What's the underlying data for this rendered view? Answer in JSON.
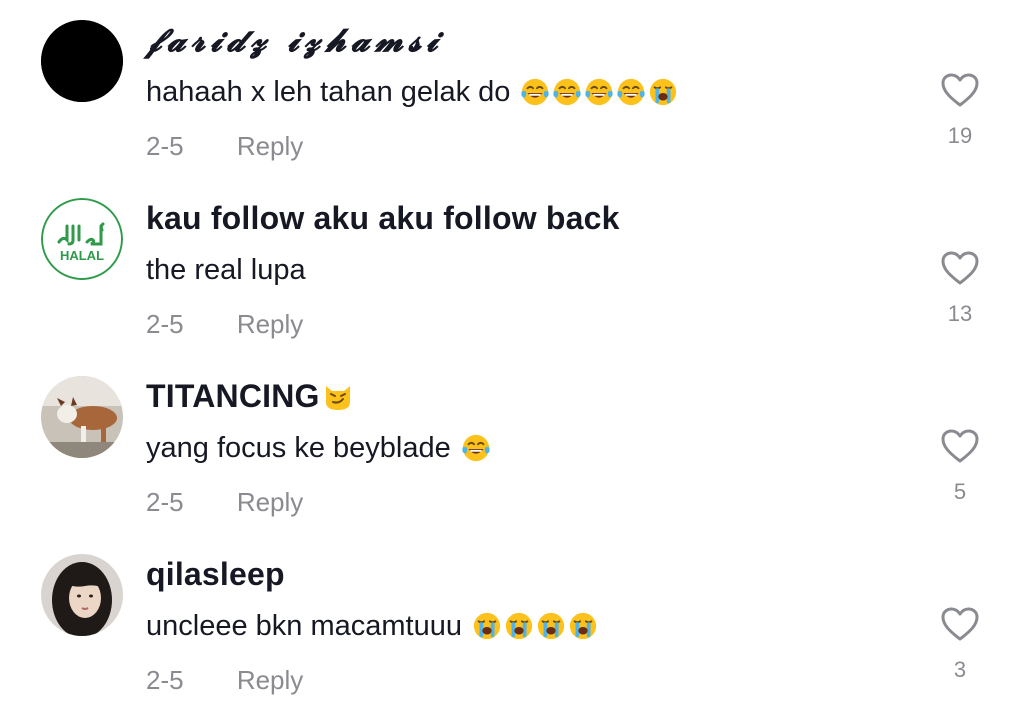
{
  "comments": [
    {
      "username": "𝓯𝓪𝓻𝓲𝓭𝔃 𝓲𝔃𝓱𝓪𝓶𝓼𝓲",
      "text": "hahaah x leh tahan gelak do",
      "emojis": [
        "face-with-tears-of-joy",
        "face-with-tears-of-joy",
        "face-with-tears-of-joy",
        "face-with-tears-of-joy",
        "loudly-crying-face"
      ],
      "date": "2-5",
      "reply_label": "Reply",
      "likes": "19",
      "avatar": "black-circle-avatar"
    },
    {
      "username": "kau follow aku aku follow back",
      "text": "the real lupa",
      "emojis": [],
      "date": "2-5",
      "reply_label": "Reply",
      "likes": "13",
      "avatar": "halal-logo-avatar",
      "avatar_text": "HALAL"
    },
    {
      "username": "TITANCING",
      "username_emoji": "smirking-cat-face",
      "text": "yang focus ke beyblade",
      "emojis": [
        "face-with-tears-of-joy"
      ],
      "date": "2-5",
      "reply_label": "Reply",
      "likes": "5",
      "avatar": "dog-photo-avatar"
    },
    {
      "username": "qilasleep",
      "text": "uncleee bkn macamtuuu",
      "emojis": [
        "loudly-crying-face",
        "loudly-crying-face",
        "loudly-crying-face",
        "loudly-crying-face"
      ],
      "date": "2-5",
      "reply_label": "Reply",
      "likes": "3",
      "avatar": "girl-photo-avatar"
    }
  ],
  "colors": {
    "text_primary": "#161823",
    "text_secondary": "#8a8b91",
    "halal_green": "#2e9a4a",
    "emoji_yellow": "#fcc21b",
    "tear_blue": "#4fb3e8"
  }
}
